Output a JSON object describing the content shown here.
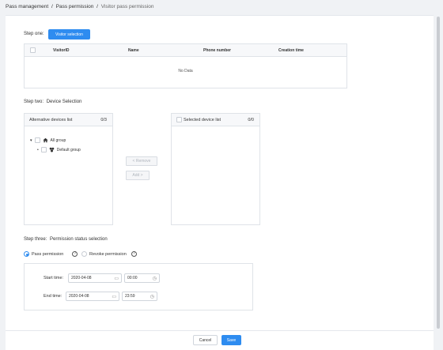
{
  "breadcrumb": {
    "item1": "Pass management",
    "item2": "Pass permission",
    "current": "Visitor pass permission",
    "sep": "/"
  },
  "step_one": {
    "label": "Step one:",
    "button": "Visitor selection",
    "table": {
      "headers": [
        "VisitorID",
        "Name",
        "Phone number",
        "Creation time"
      ],
      "empty": "No Data"
    }
  },
  "step_two": {
    "label": "Step two:",
    "title": "Device Selection",
    "left": {
      "title": "Alternative devices list",
      "count": "0/3"
    },
    "right": {
      "title": "Selected device list",
      "count": "0/0"
    },
    "tree": {
      "root": "All group",
      "child": "Default group"
    },
    "remove": "< Remove",
    "add": "Add >"
  },
  "step_three": {
    "label": "Step three:",
    "title": "Permission status selection",
    "pass": "Pass permission",
    "revoke": "Revoke permission",
    "selected": "pass",
    "start": {
      "label": "Start time:",
      "date": "2020-04-08",
      "time": "00:00"
    },
    "end": {
      "label": "End time:",
      "date": "2020-04-08",
      "time": "23:59"
    }
  },
  "footer": {
    "cancel": "Cancel",
    "save": "Save"
  },
  "colors": {
    "primary": "#2e8cf0"
  }
}
